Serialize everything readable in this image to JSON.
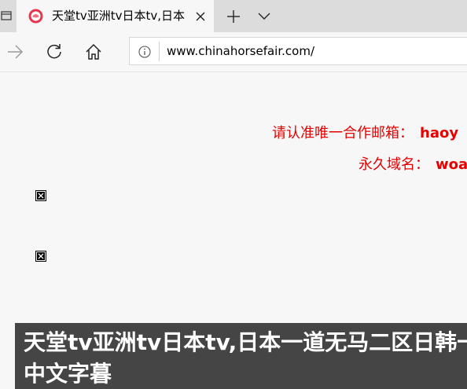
{
  "tab": {
    "title": "天堂tv亚洲tv日本tv,日本"
  },
  "address": {
    "url": "www.chinahorsefair.com/"
  },
  "page": {
    "contact_label": "请认准唯一合作邮箱：",
    "contact_value": "haoy",
    "domain_label": "永久域名：",
    "domain_value": "woa",
    "banner_title": "天堂tv亚洲tv日本tv,日本一道无马二区日韩一中文字暮"
  },
  "colors": {
    "accent_red": "#e60000",
    "banner_bg": "#454545",
    "tab_strip": "#dcdcdc"
  }
}
